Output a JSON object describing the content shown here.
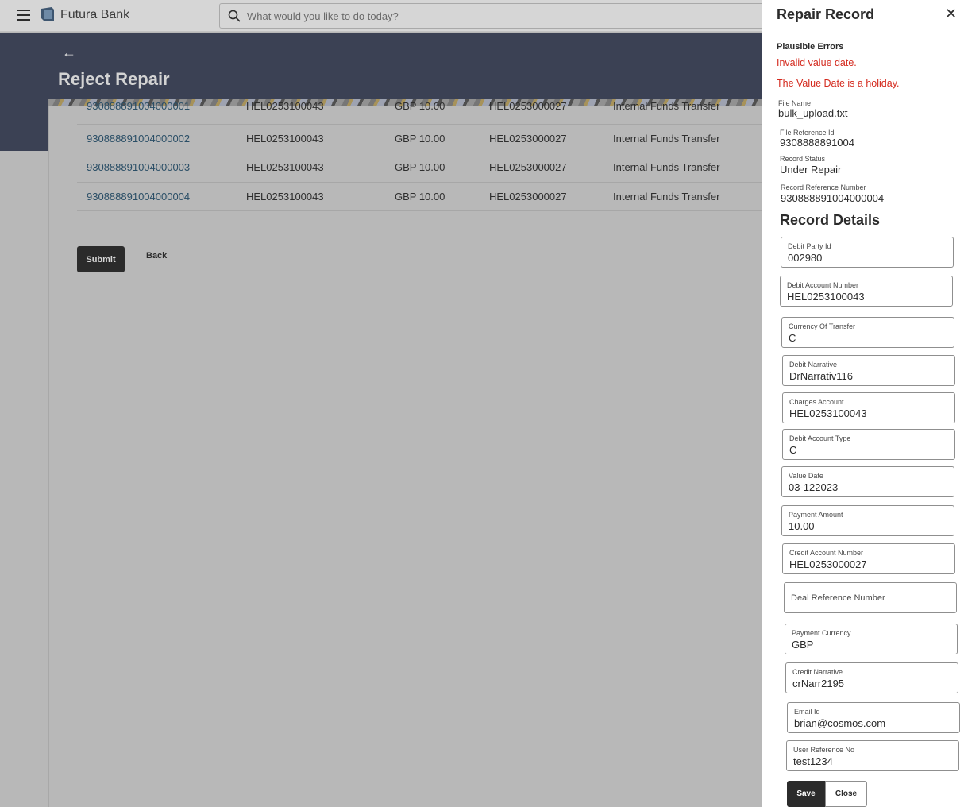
{
  "header": {
    "brand": "Futura Bank",
    "search_placeholder": "What would you like to do today?"
  },
  "page": {
    "title": "Reject Repair",
    "back_icon": "arrow-left-icon"
  },
  "records": [
    {
      "ref": "930888891004000001",
      "debit_account": "HEL0253100043",
      "amount": "GBP 10.00",
      "credit_account": "HEL0253000027",
      "type": "Internal Funds Transfer"
    },
    {
      "ref": "930888891004000002",
      "debit_account": "HEL0253100043",
      "amount": "GBP 10.00",
      "credit_account": "HEL0253000027",
      "type": "Internal Funds Transfer"
    },
    {
      "ref": "930888891004000003",
      "debit_account": "HEL0253100043",
      "amount": "GBP 10.00",
      "credit_account": "HEL0253000027",
      "type": "Internal Funds Transfer"
    },
    {
      "ref": "930888891004000004",
      "debit_account": "HEL0253100043",
      "amount": "GBP 10.00",
      "credit_account": "HEL0253000027",
      "type": "Internal Funds Transfer"
    }
  ],
  "actions": {
    "submit": "Submit",
    "back": "Back"
  },
  "panel": {
    "title": "Repair Record",
    "errors_heading": "Plausible Errors",
    "errors": [
      "Invalid value date.",
      "The Value Date is a holiday."
    ],
    "file_name_label": "File Name",
    "file_name": "bulk_upload.txt",
    "file_ref_label": "File Reference Id",
    "file_ref": "9308888891004",
    "record_status_label": "Record Status",
    "record_status": "Under Repair",
    "record_ref_label": "Record Reference Number",
    "record_ref": "930888891004000004",
    "details_heading": "Record Details",
    "fields": [
      {
        "label": "Debit Party Id",
        "value": "002980"
      },
      {
        "label": "Debit Account Number",
        "value": "HEL0253100043"
      },
      {
        "label": "Currency Of Transfer",
        "value": "C"
      },
      {
        "label": "Debit Narrative",
        "value": "DrNarrativ116"
      },
      {
        "label": "Charges Account",
        "value": "HEL0253100043"
      },
      {
        "label": "Debit Account Type",
        "value": "C"
      },
      {
        "label": "Value Date",
        "value": "03-122023"
      },
      {
        "label": "Payment Amount",
        "value": "10.00"
      },
      {
        "label": "Credit Account Number",
        "value": "HEL0253000027"
      },
      {
        "label": "Deal Reference Number",
        "value": ""
      },
      {
        "label": "Payment Currency",
        "value": "GBP"
      },
      {
        "label": "Credit Narrative",
        "value": "crNarr2195"
      },
      {
        "label": "Email Id",
        "value": "brian@cosmos.com"
      },
      {
        "label": "User Reference No",
        "value": "test1234"
      }
    ],
    "save": "Save",
    "close": "Close"
  },
  "colors": {
    "banner": "#3b4154",
    "error": "#d42a1e",
    "primary_button": "#2b2b2b",
    "link": "#2a4e66"
  }
}
